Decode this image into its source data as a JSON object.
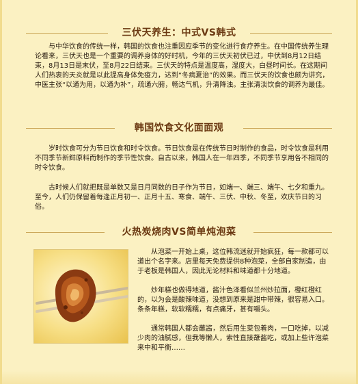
{
  "sections": [
    {
      "title": "三伏天养生：中式VS韩式",
      "paragraphs": [
        "与中华饮食的传统一样，韩国的饮食也注重因应季节的变化进行食疗养生。在中国传统养生理论看来，三伏天也是一个重要的调养身体的好时机，今年的三伏天初伏已过，中伏到8月12日结束，8月13日是末伏，至8月22日结束。三伏天的特点是温度高，湿度大，白昼时间长。在这期间人们热衷的天炎就是以此提高身体免疫力，达到“冬病夏治”的效果。而三伏天的饮食也颇为讲究，中医主张“以通为用，以通为补”，疏通六腑，畅达气机，升清降浊。主张清淡饮食的调养为最佳。"
      ]
    },
    {
      "title": "韩国饮食文化面面观",
      "paragraphs": [
        "岁时饮食可分为节日饮食和时令饮食。节日饮食是在传统节日时制作的食品，时令饮食是利用不同季节新鲜原料而制作的季节性饮食。自古以来，韩国人在一年四季，不同季节享用各不相同的时令饮食。",
        "古时候人们就把既是单数又是日月同数的日子作为节日，如端一、端三、端午、七夕和重九。至今，人们仍保留着每逢正月初一、正月十五、寒食、端午、三伏、中秋、冬至，欢庆节日的习俗。"
      ]
    },
    {
      "title": "火热炭烧肉VS简单炖泡菜",
      "paragraphs": [
        "从泡菜一开始上桌，这位韩流迷就开始疯狂，每一款都可以道出个名字来。店里每天免费提供8种泡菜，全部自家制造，由于老板是韩国人，因此无论材料和味道都十分地道。",
        "炒年糕也做得地道，酱汁色泽看似兰州炒拉面，橙红橙红的，以为会是酸辣味道，没想到原来是甜中带辣，很容易入口。条条年糕，软软糯糯，有点痛牙，甚有嚼头。",
        "通常韩国人都会蘸酱，然后用生菜包着肉，一口吃掉，以减少肉的油腻感，但我等懒人，索性直接蘸酱吃，或加上些许泡菜来中和平衡……"
      ]
    }
  ]
}
